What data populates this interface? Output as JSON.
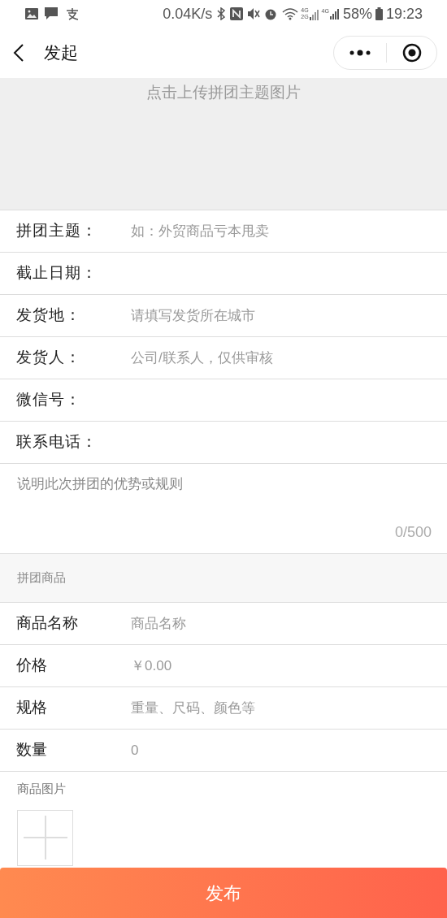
{
  "status_bar": {
    "speed": "0.04K/s",
    "network_labels": [
      "4G",
      "2G",
      "4G"
    ],
    "battery": "58%",
    "time": "19:23"
  },
  "nav": {
    "title": "发起"
  },
  "cover_upload": {
    "hint": "点击上传拼团主题图片"
  },
  "fields": [
    {
      "label": "拼团主题：",
      "placeholder": "如：外贸商品亏本甩卖"
    },
    {
      "label": "截止日期："
    },
    {
      "label": "发货地：",
      "placeholder": "请填写发货所在城市"
    },
    {
      "label": "发货人：",
      "placeholder": "公司/联系人，仅供审核"
    },
    {
      "label": "微信号："
    },
    {
      "label": "联系电话："
    }
  ],
  "description": {
    "placeholder": "说明此次拼团的优势或规则",
    "counter": "0/500"
  },
  "goods_section": {
    "title": "拼团商品"
  },
  "goods_fields": [
    {
      "label": "商品名称",
      "placeholder": "商品名称"
    },
    {
      "label": "价格",
      "placeholder": "￥0.00"
    },
    {
      "label": "规格",
      "placeholder": "重量、尺码、颜色等"
    },
    {
      "label": "数量",
      "placeholder": "0"
    }
  ],
  "goods_image": {
    "label": "商品图片"
  },
  "submit": {
    "label": "发布"
  }
}
